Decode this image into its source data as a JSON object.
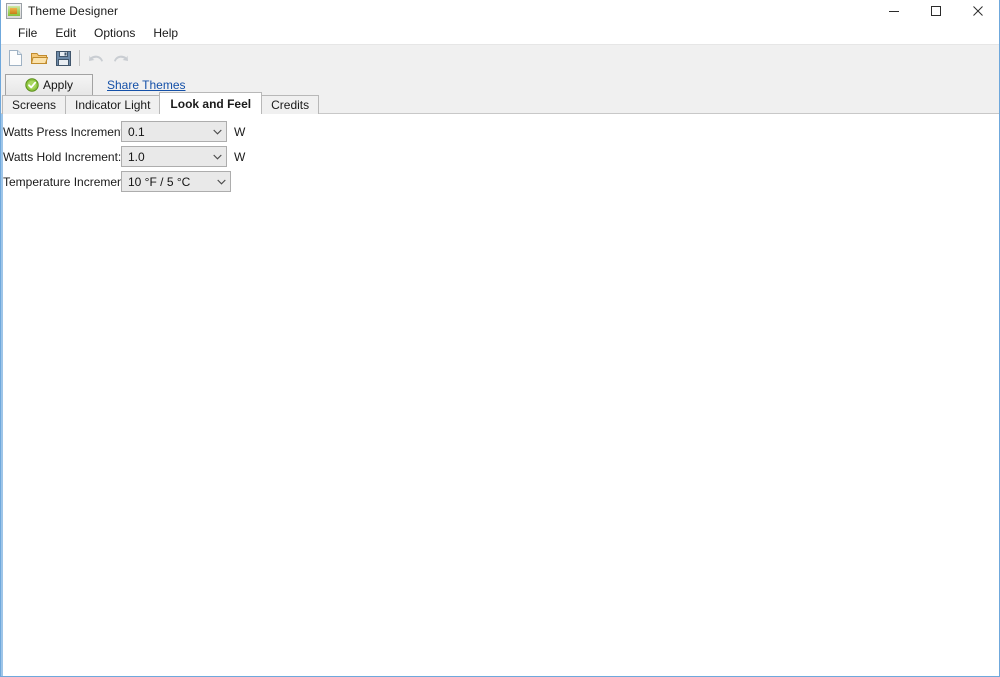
{
  "window": {
    "title": "Theme Designer",
    "app_icon": "picture-icon",
    "controls": [
      {
        "name": "minimize",
        "icon": "minimize-icon"
      },
      {
        "name": "maximize",
        "icon": "maximize-icon"
      },
      {
        "name": "close",
        "icon": "close-icon"
      }
    ]
  },
  "menubar": {
    "items": [
      {
        "label": "File"
      },
      {
        "label": "Edit"
      },
      {
        "label": "Options"
      },
      {
        "label": "Help"
      }
    ]
  },
  "toolbar": {
    "icons": [
      {
        "name": "new-file-icon",
        "enabled": true
      },
      {
        "name": "open-folder-icon",
        "enabled": true
      },
      {
        "name": "save-icon",
        "enabled": true
      },
      {
        "name": "undo-icon",
        "enabled": false
      },
      {
        "name": "redo-icon",
        "enabled": false
      }
    ],
    "apply_label": "Apply",
    "apply_icon": "green-check-icon",
    "share_label": "Share Themes"
  },
  "tabs": [
    {
      "label": "Screens",
      "active": false
    },
    {
      "label": "Indicator Light",
      "active": false
    },
    {
      "label": "Look and Feel",
      "active": true
    },
    {
      "label": "Credits",
      "active": false
    }
  ],
  "form": {
    "rows": [
      {
        "label": "Watts Press Increment:",
        "value": "0.1",
        "unit": "W"
      },
      {
        "label": "Watts Hold Increment:",
        "value": "1.0",
        "unit": "W"
      },
      {
        "label": "Temperature Increment:",
        "value": "10 °F / 5 °C",
        "unit": ""
      }
    ]
  },
  "colors": {
    "window_border": "#6fa8dc",
    "toolbar_bg": "#f0f0f0",
    "content_bg": "#ffffff",
    "link": "#1450a8",
    "combo_bg": "#e9e9e9",
    "accent_green": "#74bd2a"
  }
}
